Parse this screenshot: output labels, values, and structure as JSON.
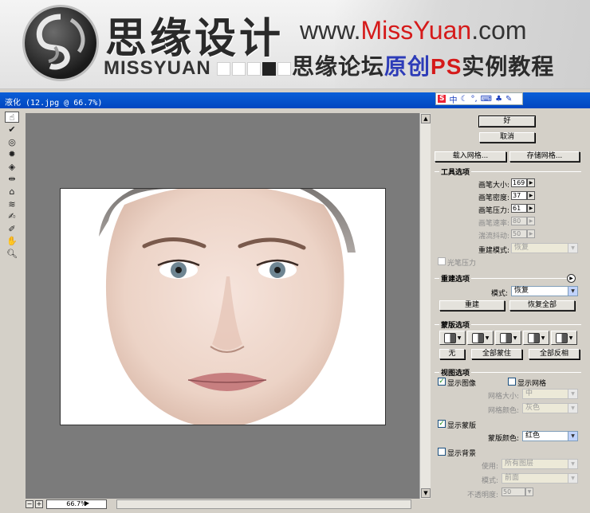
{
  "banner": {
    "brand_cn": "思缘设计",
    "brand_en": "MISSYUAN",
    "url_prefix": "www.",
    "url_red1": "Miss",
    "url_mid": "Yuan",
    "url_suffix": ".com",
    "slogan_a": "思缘论坛",
    "slogan_b": "原创",
    "slogan_c": "PS",
    "slogan_d": "实例教程"
  },
  "window": {
    "title": "液化 (12.jpg @ 66.7%)",
    "ime": {
      "s": "S",
      "mode": "中"
    }
  },
  "tools": [
    "forward-warp",
    "reconstruct",
    "twirl",
    "pucker",
    "bloat",
    "push-left",
    "mirror",
    "turbulence",
    "freeze-mask",
    "thaw-mask",
    "hand",
    "zoom"
  ],
  "status": {
    "zoom_minus": "−",
    "zoom_plus": "+",
    "zoom_value": "66.7%"
  },
  "panel": {
    "ok": "好",
    "cancel": "取消",
    "load_mesh": "载入网格...",
    "save_mesh": "存储网格...",
    "tool_options": {
      "title": "工具选项",
      "brush_size_label": "画笔大小:",
      "brush_size": "169",
      "brush_density_label": "画笔密度:",
      "brush_density": "37",
      "brush_pressure_label": "画笔压力:",
      "brush_pressure": "61",
      "brush_rate_label": "画笔速率:",
      "brush_rate": "80",
      "turbulent_jitter_label": "湍流抖动:",
      "turbulent_jitter": "50",
      "reconstruct_mode_label": "重建模式:",
      "reconstruct_mode": "恢复",
      "stylus_pressure": "光笔压力"
    },
    "reconstruct_options": {
      "title": "重建选项",
      "mode_label": "模式:",
      "mode": "恢复",
      "reconstruct": "重建",
      "restore_all": "恢复全部"
    },
    "mask_options": {
      "title": "蒙版选项",
      "none": "无",
      "mask_all": "全部蒙住",
      "invert_all": "全部反相"
    },
    "view_options": {
      "title": "视图选项",
      "show_image": "显示图像",
      "show_mesh": "显示网格",
      "mesh_size_label": "网格大小:",
      "mesh_size": "中",
      "mesh_color_label": "网格颜色:",
      "mesh_color": "灰色",
      "show_mask": "显示蒙版",
      "mask_color_label": "蒙版颜色:",
      "mask_color": "红色",
      "show_backdrop": "显示背景",
      "use_label": "使用:",
      "use": "所有图层",
      "mode_label": "模式:",
      "mode": "前面",
      "opacity_label": "不透明度:",
      "opacity": "50"
    }
  }
}
